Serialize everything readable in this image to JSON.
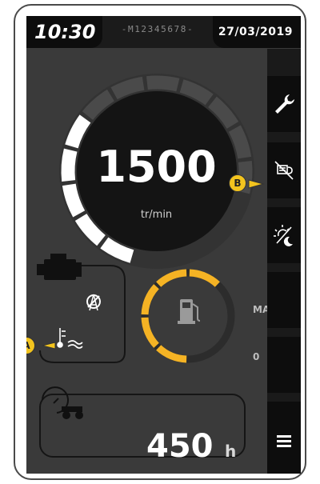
{
  "header": {
    "time": "10:30",
    "serial": "-M12345678-",
    "date": "27/03/2019"
  },
  "engine": {
    "rpm_value": "1500",
    "rpm_unit": "tr/min",
    "rpm_level": 0.45
  },
  "fuel": {
    "max_label": "MAX",
    "zero_label": "0",
    "level": 0.82
  },
  "hour_meter": {
    "value": "450",
    "unit": "h"
  },
  "sidebar": {
    "items": [
      {
        "icon": "wrench-icon"
      },
      {
        "icon": "regeneration-inhibit-icon"
      },
      {
        "icon": "day-night-icon"
      },
      {
        "icon": "empty"
      },
      {
        "icon": "empty"
      },
      {
        "icon": "menu-icon"
      }
    ]
  },
  "callouts": {
    "a": "A",
    "b": "B"
  },
  "colors": {
    "screen_bg": "#3a3a3a",
    "fuel_accent": "#f5b324",
    "callout_bg": "#f3c41e",
    "rpm_active": "#ffffff",
    "rpm_inactive": "#4a4a4a"
  }
}
